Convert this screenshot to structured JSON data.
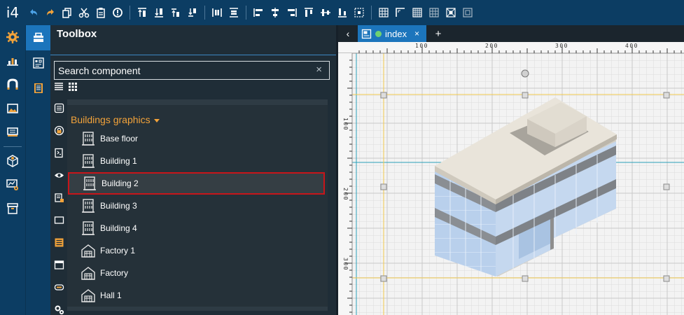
{
  "app": {
    "logo": "i4"
  },
  "toolbar": {
    "icons": [
      "undo-icon",
      "redo-icon",
      "copy-icon",
      "cut-icon",
      "paste-icon",
      "info-icon",
      "bring-front-icon",
      "send-back-icon",
      "bring-forward-icon",
      "send-backward-icon",
      "distribute-h-icon",
      "distribute-v-icon",
      "align-left-icon",
      "align-center-icon",
      "align-right-icon",
      "align-top-icon",
      "align-middle-icon",
      "align-bottom-icon",
      "group-select-icon",
      "grid-icon",
      "corner-icon",
      "grid-fine-icon",
      "grid-snap-icon",
      "grid-center-icon",
      "grid-scale-icon"
    ]
  },
  "toolbox": {
    "title": "Toolbox",
    "search_placeholder": "Search component",
    "search_clear": "×",
    "group_title": "Buildings graphics",
    "items": [
      {
        "label": "Base floor",
        "icon": "building-icon"
      },
      {
        "label": "Building 1",
        "icon": "building-icon"
      },
      {
        "label": "Building 2",
        "icon": "building-icon",
        "selected": true
      },
      {
        "label": "Building 3",
        "icon": "building-icon"
      },
      {
        "label": "Building 4",
        "icon": "building-icon"
      },
      {
        "label": "Factory 1",
        "icon": "factory-icon"
      },
      {
        "label": "Factory",
        "icon": "factory-icon"
      },
      {
        "label": "Hall 1",
        "icon": "factory-icon"
      }
    ]
  },
  "tabs": {
    "back": "‹",
    "active_tab": "index",
    "close": "×",
    "add": "+"
  },
  "rulers": {
    "horizontal": [
      "100",
      "200",
      "300",
      "400"
    ],
    "vertical": [
      "100",
      "200",
      "300"
    ]
  },
  "colors": {
    "accent": "#1c75bc",
    "group": "#f3a33a",
    "selection": "#c8151a",
    "status": "#6fd172"
  }
}
